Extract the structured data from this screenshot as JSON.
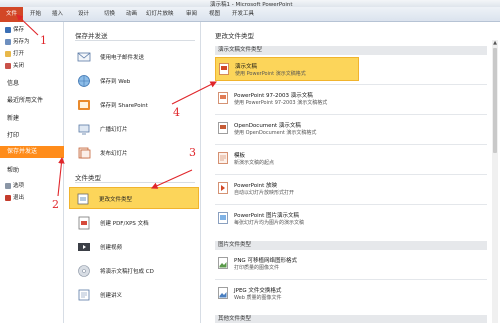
{
  "window": {
    "title": "演示稿1 - Microsoft PowerPoint"
  },
  "ribbon": {
    "tabs": [
      "文件",
      "开始",
      "插入",
      "设计",
      "切换",
      "动画",
      "幻灯片放映",
      "审阅",
      "视图",
      "开发工具"
    ]
  },
  "left_nav": {
    "items": [
      {
        "label": "保存",
        "icon": "save-icon"
      },
      {
        "label": "另存为",
        "icon": "save-as-icon"
      },
      {
        "label": "打开",
        "icon": "open-folder-icon"
      },
      {
        "label": "关闭",
        "icon": "close-file-icon"
      },
      {
        "label": "信息"
      },
      {
        "label": "最近所用文件"
      },
      {
        "label": "新建"
      },
      {
        "label": "打印"
      },
      {
        "label": "保存并发送",
        "active": true
      },
      {
        "label": "帮助"
      },
      {
        "label": "选项",
        "icon": "options-icon"
      },
      {
        "label": "退出",
        "icon": "exit-icon"
      }
    ]
  },
  "mid_panel": {
    "section1_title": "保存并发送",
    "section1_items": [
      {
        "label": "使用电子邮件发送",
        "icon": "email-icon"
      },
      {
        "label": "保存到 Web",
        "icon": "web-globe-icon"
      },
      {
        "label": "保存到 SharePoint",
        "icon": "sharepoint-icon"
      },
      {
        "label": "广播幻灯片",
        "icon": "broadcast-icon"
      },
      {
        "label": "发布幻灯片",
        "icon": "publish-slides-icon"
      }
    ],
    "section2_title": "文件类型",
    "section2_items": [
      {
        "label": "更改文件类型",
        "icon": "change-file-type-icon",
        "active": true
      },
      {
        "label": "创建 PDF/XPS 文档",
        "icon": "pdf-icon"
      },
      {
        "label": "创建视频",
        "icon": "video-icon"
      },
      {
        "label": "将演示文稿打包成 CD",
        "icon": "cd-icon"
      },
      {
        "label": "创建讲义",
        "icon": "handout-icon"
      }
    ]
  },
  "right_panel": {
    "header": "更改文件类型",
    "group1_title": "演示文稿文件类型",
    "group1_items": [
      {
        "name": "演示文稿",
        "desc": "使用 PowerPoint 演示文稿格式",
        "icon": "pptx-file-icon",
        "active": true
      },
      {
        "name": "PowerPoint 97-2003 演示文稿",
        "desc": "使用 PowerPoint 97-2003 演示文稿格式",
        "icon": "ppt-legacy-file-icon"
      },
      {
        "name": "OpenDocument 演示文稿",
        "desc": "使用 OpenDocument 演示文稿格式",
        "icon": "odp-file-icon"
      },
      {
        "name": "模板",
        "desc": "新演示文稿的起点",
        "icon": "template-file-icon"
      },
      {
        "name": "PowerPoint 放映",
        "desc": "自动以幻灯片放映形式打开",
        "icon": "ppsx-file-icon"
      },
      {
        "name": "PowerPoint 图片演示文稿",
        "desc": "每张幻灯片均为图片的演示文稿",
        "icon": "picture-presentation-icon"
      }
    ],
    "group2_title": "图片文件类型",
    "group2_items": [
      {
        "name": "PNG 可移植网络图形格式",
        "desc": "打印质量的图像文件",
        "icon": "png-file-icon"
      },
      {
        "name": "JPEG 文件交换格式",
        "desc": "Web 质量的图像文件",
        "icon": "jpeg-file-icon"
      }
    ],
    "group3_title": "其他文件类型"
  },
  "annotations": [
    "1",
    "2",
    "3",
    "4"
  ],
  "colors": {
    "file_tab": "#d24726",
    "active_nav": "#ff8c1a",
    "highlight": "#fcd55a",
    "highlight_border": "#f1b42d",
    "annotation": "#e0262b"
  }
}
